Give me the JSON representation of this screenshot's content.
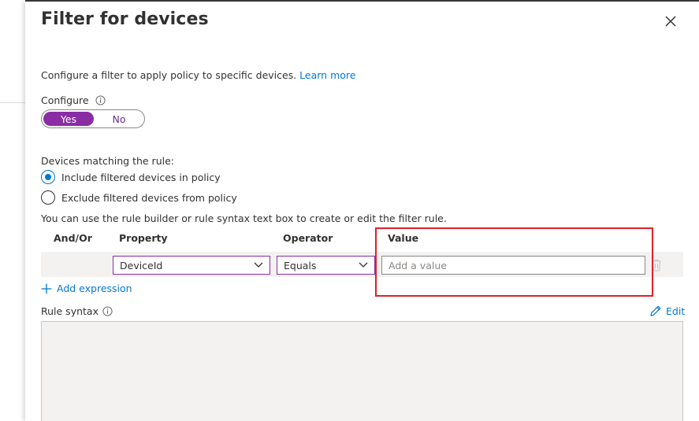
{
  "panel": {
    "title": "Filter for devices",
    "description": "Configure a filter to apply policy to specific devices.",
    "learn_more": "Learn more"
  },
  "configure": {
    "label": "Configure",
    "yes_label": "Yes",
    "no_label": "No",
    "selected": "Yes"
  },
  "matching": {
    "label": "Devices matching the rule:",
    "options": [
      {
        "label": "Include filtered devices in policy",
        "checked": true
      },
      {
        "label": "Exclude filtered devices from policy",
        "checked": false
      }
    ]
  },
  "rule_builder": {
    "hint": "You can use the rule builder or rule syntax text box to create or edit the filter rule.",
    "columns": {
      "and_or": "And/Or",
      "property": "Property",
      "operator": "Operator",
      "value": "Value"
    },
    "row": {
      "property": "DeviceId",
      "operator": "Equals",
      "value": "",
      "value_placeholder": "Add a value"
    },
    "add_expression": "Add expression"
  },
  "rule_syntax": {
    "label": "Rule syntax",
    "edit_label": "Edit",
    "value": ""
  },
  "colors": {
    "accent": "#8a2da5",
    "link": "#0078d4",
    "highlight": "#e0212b"
  }
}
